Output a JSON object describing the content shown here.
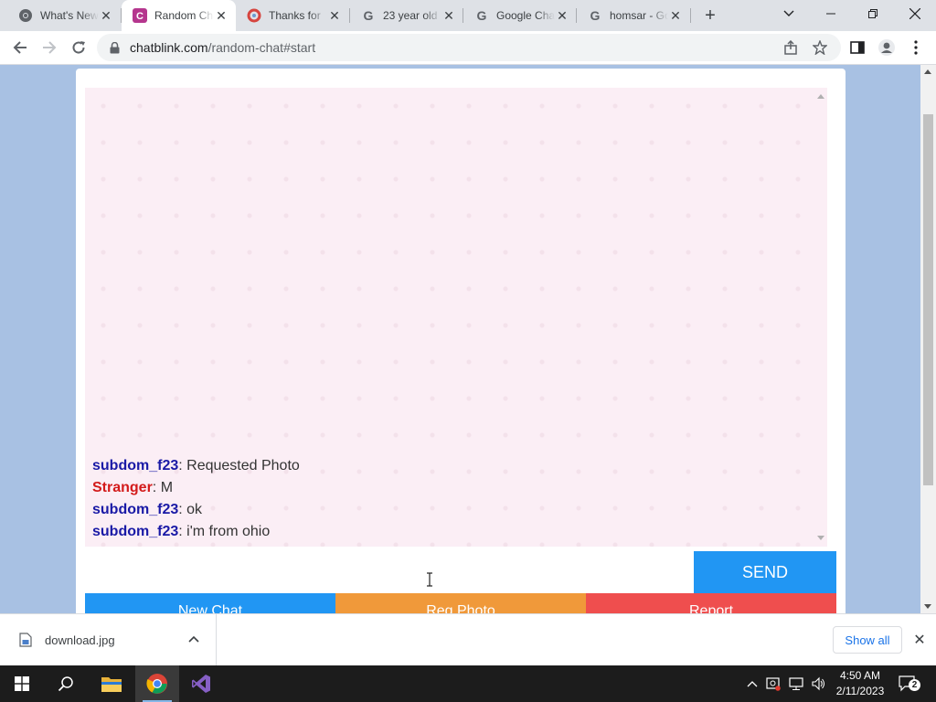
{
  "browser": {
    "tabs": [
      {
        "title": "What's New",
        "icon": "chrome-icon",
        "active": false
      },
      {
        "title": "Random Chat",
        "icon": "chatblink-icon",
        "active": true
      },
      {
        "title": "Thanks for",
        "icon": "swirl-icon",
        "active": false
      },
      {
        "title": "23 year old",
        "icon": "google-icon",
        "active": false
      },
      {
        "title": "Google Chat",
        "icon": "google-icon",
        "active": false
      },
      {
        "title": "homsar - Go",
        "icon": "google-icon",
        "active": false
      }
    ],
    "new_tab_glyph": "+",
    "url_host": "chatblink.com",
    "url_path": "/random-chat#start"
  },
  "chat": {
    "messages": [
      {
        "sender": "subdom_f23",
        "role": "you",
        "text": ": Requested Photo"
      },
      {
        "sender": "Stranger",
        "role": "stranger",
        "text": ": M"
      },
      {
        "sender": "subdom_f23",
        "role": "you",
        "text": ": ok"
      },
      {
        "sender": "subdom_f23",
        "role": "you",
        "text": ": i'm from ohio"
      }
    ],
    "input_value": "",
    "send_label": "SEND",
    "buttons": {
      "new_chat": "New Chat",
      "req_photo": "Req Photo",
      "report": "Report"
    },
    "colors": {
      "send": "#2196f3",
      "new_chat": "#2196f3",
      "req_photo": "#f0993a",
      "report": "#ef4e4e",
      "you": "#1a1aa6",
      "stranger": "#d31b1b"
    }
  },
  "downloads": {
    "file_name": "download.jpg",
    "show_all_label": "Show all"
  },
  "taskbar": {
    "time": "4:50 AM",
    "date": "2/11/2023",
    "notification_count": "2"
  }
}
